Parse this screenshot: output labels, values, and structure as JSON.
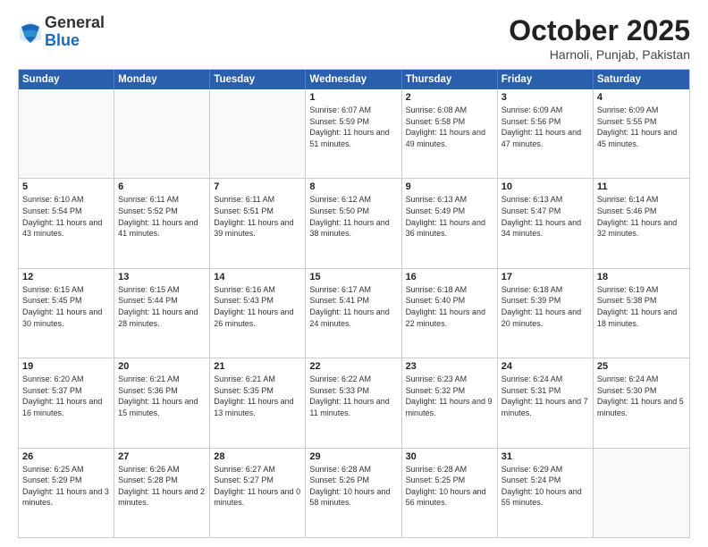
{
  "logo": {
    "general": "General",
    "blue": "Blue"
  },
  "title": {
    "month": "October 2025",
    "location": "Harnoli, Punjab, Pakistan"
  },
  "weekdays": [
    "Sunday",
    "Monday",
    "Tuesday",
    "Wednesday",
    "Thursday",
    "Friday",
    "Saturday"
  ],
  "weeks": [
    [
      {
        "day": "",
        "sunrise": "",
        "sunset": "",
        "daylight": ""
      },
      {
        "day": "",
        "sunrise": "",
        "sunset": "",
        "daylight": ""
      },
      {
        "day": "",
        "sunrise": "",
        "sunset": "",
        "daylight": ""
      },
      {
        "day": "1",
        "sunrise": "Sunrise: 6:07 AM",
        "sunset": "Sunset: 5:59 PM",
        "daylight": "Daylight: 11 hours and 51 minutes."
      },
      {
        "day": "2",
        "sunrise": "Sunrise: 6:08 AM",
        "sunset": "Sunset: 5:58 PM",
        "daylight": "Daylight: 11 hours and 49 minutes."
      },
      {
        "day": "3",
        "sunrise": "Sunrise: 6:09 AM",
        "sunset": "Sunset: 5:56 PM",
        "daylight": "Daylight: 11 hours and 47 minutes."
      },
      {
        "day": "4",
        "sunrise": "Sunrise: 6:09 AM",
        "sunset": "Sunset: 5:55 PM",
        "daylight": "Daylight: 11 hours and 45 minutes."
      }
    ],
    [
      {
        "day": "5",
        "sunrise": "Sunrise: 6:10 AM",
        "sunset": "Sunset: 5:54 PM",
        "daylight": "Daylight: 11 hours and 43 minutes."
      },
      {
        "day": "6",
        "sunrise": "Sunrise: 6:11 AM",
        "sunset": "Sunset: 5:52 PM",
        "daylight": "Daylight: 11 hours and 41 minutes."
      },
      {
        "day": "7",
        "sunrise": "Sunrise: 6:11 AM",
        "sunset": "Sunset: 5:51 PM",
        "daylight": "Daylight: 11 hours and 39 minutes."
      },
      {
        "day": "8",
        "sunrise": "Sunrise: 6:12 AM",
        "sunset": "Sunset: 5:50 PM",
        "daylight": "Daylight: 11 hours and 38 minutes."
      },
      {
        "day": "9",
        "sunrise": "Sunrise: 6:13 AM",
        "sunset": "Sunset: 5:49 PM",
        "daylight": "Daylight: 11 hours and 36 minutes."
      },
      {
        "day": "10",
        "sunrise": "Sunrise: 6:13 AM",
        "sunset": "Sunset: 5:47 PM",
        "daylight": "Daylight: 11 hours and 34 minutes."
      },
      {
        "day": "11",
        "sunrise": "Sunrise: 6:14 AM",
        "sunset": "Sunset: 5:46 PM",
        "daylight": "Daylight: 11 hours and 32 minutes."
      }
    ],
    [
      {
        "day": "12",
        "sunrise": "Sunrise: 6:15 AM",
        "sunset": "Sunset: 5:45 PM",
        "daylight": "Daylight: 11 hours and 30 minutes."
      },
      {
        "day": "13",
        "sunrise": "Sunrise: 6:15 AM",
        "sunset": "Sunset: 5:44 PM",
        "daylight": "Daylight: 11 hours and 28 minutes."
      },
      {
        "day": "14",
        "sunrise": "Sunrise: 6:16 AM",
        "sunset": "Sunset: 5:43 PM",
        "daylight": "Daylight: 11 hours and 26 minutes."
      },
      {
        "day": "15",
        "sunrise": "Sunrise: 6:17 AM",
        "sunset": "Sunset: 5:41 PM",
        "daylight": "Daylight: 11 hours and 24 minutes."
      },
      {
        "day": "16",
        "sunrise": "Sunrise: 6:18 AM",
        "sunset": "Sunset: 5:40 PM",
        "daylight": "Daylight: 11 hours and 22 minutes."
      },
      {
        "day": "17",
        "sunrise": "Sunrise: 6:18 AM",
        "sunset": "Sunset: 5:39 PM",
        "daylight": "Daylight: 11 hours and 20 minutes."
      },
      {
        "day": "18",
        "sunrise": "Sunrise: 6:19 AM",
        "sunset": "Sunset: 5:38 PM",
        "daylight": "Daylight: 11 hours and 18 minutes."
      }
    ],
    [
      {
        "day": "19",
        "sunrise": "Sunrise: 6:20 AM",
        "sunset": "Sunset: 5:37 PM",
        "daylight": "Daylight: 11 hours and 16 minutes."
      },
      {
        "day": "20",
        "sunrise": "Sunrise: 6:21 AM",
        "sunset": "Sunset: 5:36 PM",
        "daylight": "Daylight: 11 hours and 15 minutes."
      },
      {
        "day": "21",
        "sunrise": "Sunrise: 6:21 AM",
        "sunset": "Sunset: 5:35 PM",
        "daylight": "Daylight: 11 hours and 13 minutes."
      },
      {
        "day": "22",
        "sunrise": "Sunrise: 6:22 AM",
        "sunset": "Sunset: 5:33 PM",
        "daylight": "Daylight: 11 hours and 11 minutes."
      },
      {
        "day": "23",
        "sunrise": "Sunrise: 6:23 AM",
        "sunset": "Sunset: 5:32 PM",
        "daylight": "Daylight: 11 hours and 9 minutes."
      },
      {
        "day": "24",
        "sunrise": "Sunrise: 6:24 AM",
        "sunset": "Sunset: 5:31 PM",
        "daylight": "Daylight: 11 hours and 7 minutes."
      },
      {
        "day": "25",
        "sunrise": "Sunrise: 6:24 AM",
        "sunset": "Sunset: 5:30 PM",
        "daylight": "Daylight: 11 hours and 5 minutes."
      }
    ],
    [
      {
        "day": "26",
        "sunrise": "Sunrise: 6:25 AM",
        "sunset": "Sunset: 5:29 PM",
        "daylight": "Daylight: 11 hours and 3 minutes."
      },
      {
        "day": "27",
        "sunrise": "Sunrise: 6:26 AM",
        "sunset": "Sunset: 5:28 PM",
        "daylight": "Daylight: 11 hours and 2 minutes."
      },
      {
        "day": "28",
        "sunrise": "Sunrise: 6:27 AM",
        "sunset": "Sunset: 5:27 PM",
        "daylight": "Daylight: 11 hours and 0 minutes."
      },
      {
        "day": "29",
        "sunrise": "Sunrise: 6:28 AM",
        "sunset": "Sunset: 5:26 PM",
        "daylight": "Daylight: 10 hours and 58 minutes."
      },
      {
        "day": "30",
        "sunrise": "Sunrise: 6:28 AM",
        "sunset": "Sunset: 5:25 PM",
        "daylight": "Daylight: 10 hours and 56 minutes."
      },
      {
        "day": "31",
        "sunrise": "Sunrise: 6:29 AM",
        "sunset": "Sunset: 5:24 PM",
        "daylight": "Daylight: 10 hours and 55 minutes."
      },
      {
        "day": "",
        "sunrise": "",
        "sunset": "",
        "daylight": ""
      }
    ]
  ]
}
